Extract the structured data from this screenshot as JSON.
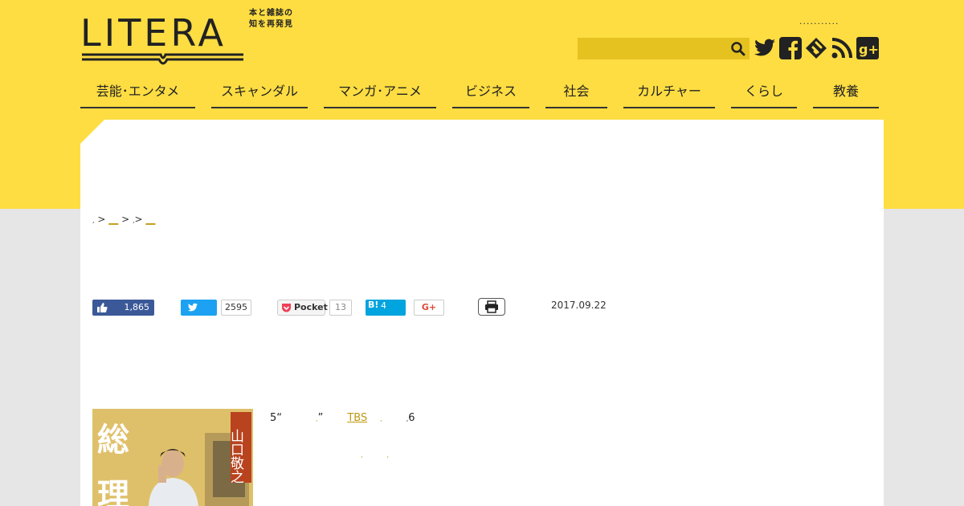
{
  "header": {
    "logo_text": "LITERA",
    "tagline_line1": "本と雑誌の",
    "tagline_line2": "知を再発見",
    "dots": "...........",
    "search_placeholder": ""
  },
  "icons": {
    "search": "search-icon",
    "twitter": "twitter-icon",
    "facebook": "facebook-icon",
    "feedly": "feedly-icon",
    "rss": "rss-icon",
    "googleplus": "google-plus-icon"
  },
  "nav": [
    {
      "label": "芸能･エンタメ"
    },
    {
      "label": "スキャンダル"
    },
    {
      "label": "マンガ･アニメ"
    },
    {
      "label": "ビジネス"
    },
    {
      "label": "社会"
    },
    {
      "label": "カルチャー"
    },
    {
      "label": "くらし"
    },
    {
      "label": "教養"
    }
  ],
  "breadcrumb": {
    "sep1": ",",
    "arrow": ">",
    "link1": "__",
    "sep2": ",",
    "link2": "__"
  },
  "share": {
    "facebook_count": "1,865",
    "twitter_count": "2595",
    "pocket_label": "Pocket",
    "pocket_count": "13",
    "hatena_label": "B!",
    "hatena_count": "4",
    "gplus_label": "G+"
  },
  "article": {
    "date": "2017.09.22",
    "book_title_big1": "総",
    "book_title_big2": "理",
    "book_author": "山口敬之",
    "text_prefix": "5“",
    "text_comma1": ",",
    "text_quote": "”",
    "text_link": "TBS",
    "text_comma2": ",",
    "text_comma3": ",",
    "text_suffix": "6",
    "text2_a": ",",
    "text2_b": ","
  },
  "colors": {
    "header_yellow": "#fedd42",
    "link_gold": "#c09a10",
    "facebook": "#3b5998",
    "twitter": "#1da1f2",
    "hatena": "#00a4de"
  }
}
